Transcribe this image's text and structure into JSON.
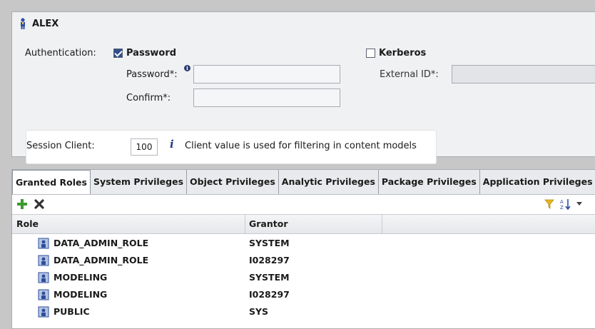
{
  "user": {
    "name": "ALEX",
    "icon": "user-icon"
  },
  "auth": {
    "label": "Authentication:",
    "password_option": "Password",
    "password_checked": true,
    "kerberos_option": "Kerberos",
    "kerberos_checked": false,
    "password_label": "Password*:",
    "confirm_label": "Confirm*:",
    "external_id_label": "External ID*:",
    "password_value": "",
    "confirm_value": "",
    "external_id_value": ""
  },
  "session": {
    "label": "Session Client:",
    "value": "100",
    "info_text": "Client value is used for filtering in content models"
  },
  "tabs": [
    {
      "label": "Granted Roles",
      "active": true
    },
    {
      "label": "System Privileges",
      "active": false
    },
    {
      "label": "Object Privileges",
      "active": false
    },
    {
      "label": "Analytic Privileges",
      "active": false
    },
    {
      "label": "Package Privileges",
      "active": false
    },
    {
      "label": "Application Privileges",
      "active": false
    }
  ],
  "toolbar": {
    "add_icon": "plus-icon",
    "remove_icon": "x-icon",
    "filter_icon": "filter-icon",
    "sort_icon": "sort-icon",
    "menu_icon": "chevron-down-icon"
  },
  "grid": {
    "columns": [
      "Role",
      "Grantor"
    ],
    "rows": [
      {
        "role": "DATA_ADMIN_ROLE",
        "grantor": "SYSTEM"
      },
      {
        "role": "DATA_ADMIN_ROLE",
        "grantor": "I028297"
      },
      {
        "role": "MODELING",
        "grantor": "SYSTEM"
      },
      {
        "role": "MODELING",
        "grantor": "I028297"
      },
      {
        "role": "PUBLIC",
        "grantor": "SYS"
      }
    ]
  },
  "colors": {
    "accent": "#1f3c88",
    "add_green": "#3c9a2e",
    "panel_bg": "#f0f1f3"
  }
}
